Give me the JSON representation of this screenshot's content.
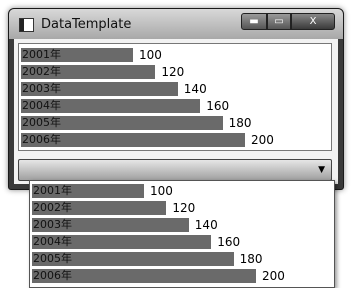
{
  "window": {
    "title": "DataTemplate",
    "min_label": "▬",
    "max_label": "▭",
    "close_label": "X"
  },
  "listbox": {
    "items": [
      {
        "year": "2001年",
        "value": "100"
      },
      {
        "year": "2002年",
        "value": "120"
      },
      {
        "year": "2003年",
        "value": "140"
      },
      {
        "year": "2004年",
        "value": "160"
      },
      {
        "year": "2005年",
        "value": "180"
      },
      {
        "year": "2006年",
        "value": "200"
      }
    ]
  },
  "combobox": {
    "selected": "",
    "arrow": "▼",
    "items": [
      {
        "year": "2001年",
        "value": "100"
      },
      {
        "year": "2002年",
        "value": "120"
      },
      {
        "year": "2003年",
        "value": "140"
      },
      {
        "year": "2004年",
        "value": "160"
      },
      {
        "year": "2005年",
        "value": "180"
      },
      {
        "year": "2006年",
        "value": "200"
      }
    ]
  }
}
